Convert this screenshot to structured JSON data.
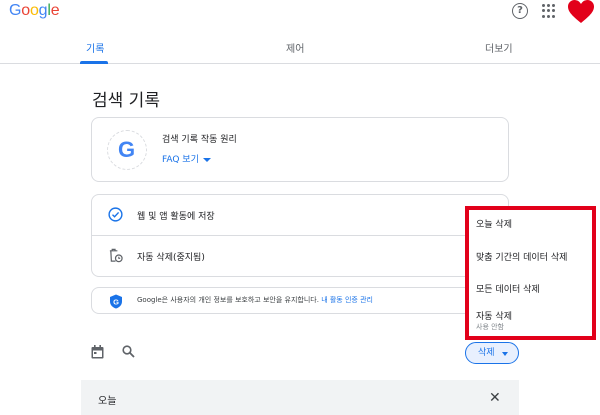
{
  "header": {
    "logo": [
      "G",
      "o",
      "o",
      "g",
      "l",
      "e"
    ],
    "help_icon_glyph": "?"
  },
  "tabs": [
    {
      "label": "기록",
      "active": true
    },
    {
      "label": "제어",
      "active": false
    },
    {
      "label": "더보기",
      "active": false
    }
  ],
  "page_title": "검색 기록",
  "auto_delete_card": {
    "title": "검색 기록 작동 원리",
    "faq_label": "FAQ 보기",
    "logo_letter": "G"
  },
  "settings": [
    {
      "label": "웹 및 앱 활동에 저장",
      "icon": "check-circle-icon"
    },
    {
      "label": "자동 삭제(중지됨)",
      "icon": "auto-delete-icon"
    }
  ],
  "privacy": {
    "text": "Google은 사용자의 개인 정보를 보호하고 보안을 유지합니다.",
    "link": "내 활동 인증 관리"
  },
  "toolbar": {
    "delete_label": "삭제"
  },
  "today": {
    "label": "오늘",
    "close_glyph": "✕"
  },
  "delete_menu": {
    "items": [
      "오늘 삭제",
      "맞춤 기간의 데이터 삭제",
      "모든 데이터 삭제",
      "자동 삭제"
    ],
    "auto_delete_sub": "사용 안함"
  },
  "colors": {
    "accent": "#1a73e8",
    "highlight_border": "#e2001a",
    "avatar": "#e2001a"
  }
}
